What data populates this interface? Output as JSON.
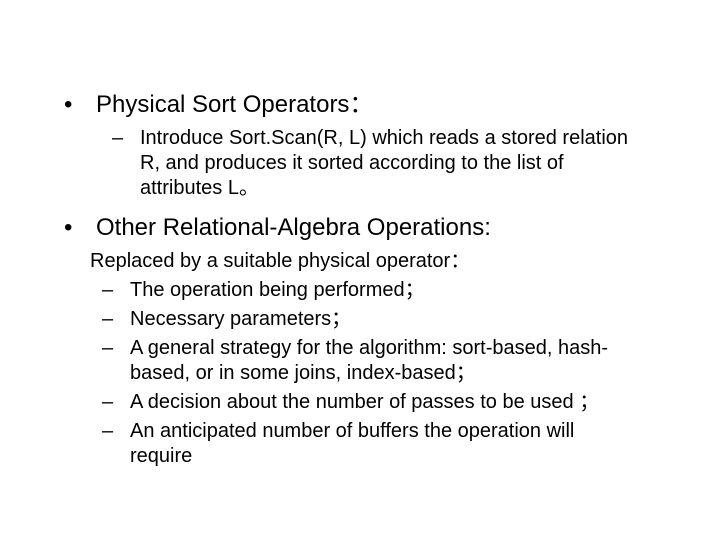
{
  "slide": {
    "bullets": [
      {
        "level": 1,
        "text": "Physical Sort Operators："
      },
      {
        "level": 2,
        "text": "Introduce Sort.Scan(R, L) which reads a stored relation R, and produces it sorted according to the list of attributes L。"
      },
      {
        "level": 1,
        "text": "Other Relational-Algebra Operations:"
      }
    ],
    "sub_intro": "Replaced by a suitable physical operator：",
    "sub_bullets": [
      "The operation being performed；",
      "Necessary parameters；",
      "A general strategy for the algorithm: sort-based, hash-based, or in some joins, index-based；",
      "A decision about the number of passes to be used ；",
      "An anticipated number of buffers the operation will require"
    ]
  }
}
